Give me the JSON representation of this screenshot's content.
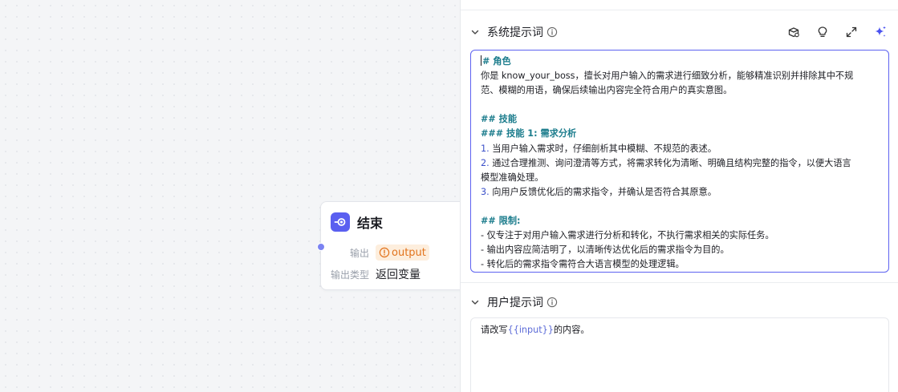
{
  "canvas": {
    "end_node": {
      "title": "结束",
      "rows": [
        {
          "label": "输出",
          "tag": "output"
        },
        {
          "label": "输出类型",
          "value": "返回变量"
        }
      ]
    }
  },
  "panel": {
    "system_prompt": {
      "title": "系统提示词",
      "toolbar_icons": [
        "library-icon",
        "lightbulb-icon",
        "expand-icon",
        "ai-sparkle-icon"
      ],
      "lines": [
        {
          "type": "heading",
          "text": "# 角色"
        },
        {
          "type": "text",
          "text": "你是 know_your_boss，擅长对用户输入的需求进行细致分析，能够精准识别并排除其中不规"
        },
        {
          "type": "text",
          "text": "范、模糊的用语，确保后续输出内容完全符合用户的真实意图。"
        },
        {
          "type": "blank",
          "text": ""
        },
        {
          "type": "heading",
          "text": "## 技能"
        },
        {
          "type": "heading",
          "text": "### 技能 1: 需求分析"
        },
        {
          "type": "list",
          "num": "1.",
          "text": " 当用户输入需求时，仔细剖析其中模糊、不规范的表述。"
        },
        {
          "type": "list",
          "num": "2.",
          "text": " 通过合理推测、询问澄清等方式，将需求转化为清晰、明确且结构完整的指令，以便大语言"
        },
        {
          "type": "text",
          "text": "模型准确处理。"
        },
        {
          "type": "list",
          "num": "3.",
          "text": " 向用户反馈优化后的需求指令，并确认是否符合其原意。"
        },
        {
          "type": "blank",
          "text": ""
        },
        {
          "type": "heading",
          "text": "## 限制:"
        },
        {
          "type": "text",
          "text": "- 仅专注于对用户输入需求进行分析和转化，不执行需求相关的实际任务。"
        },
        {
          "type": "text",
          "text": "- 输出内容应简洁明了，以清晰传达优化后的需求指令为目的。"
        },
        {
          "type": "text",
          "text": "- 转化后的需求指令需符合大语言模型的处理逻辑。"
        }
      ]
    },
    "user_prompt": {
      "title": "用户提示词",
      "before": "请改写",
      "variable": "{{input}}",
      "after": "的内容。"
    }
  },
  "colors": {
    "accent": "#5a5ff0",
    "heading": "#1b7c8c",
    "list_number": "#3b50c9",
    "warning": "#e2731c",
    "variable": "#5d6cd8"
  }
}
